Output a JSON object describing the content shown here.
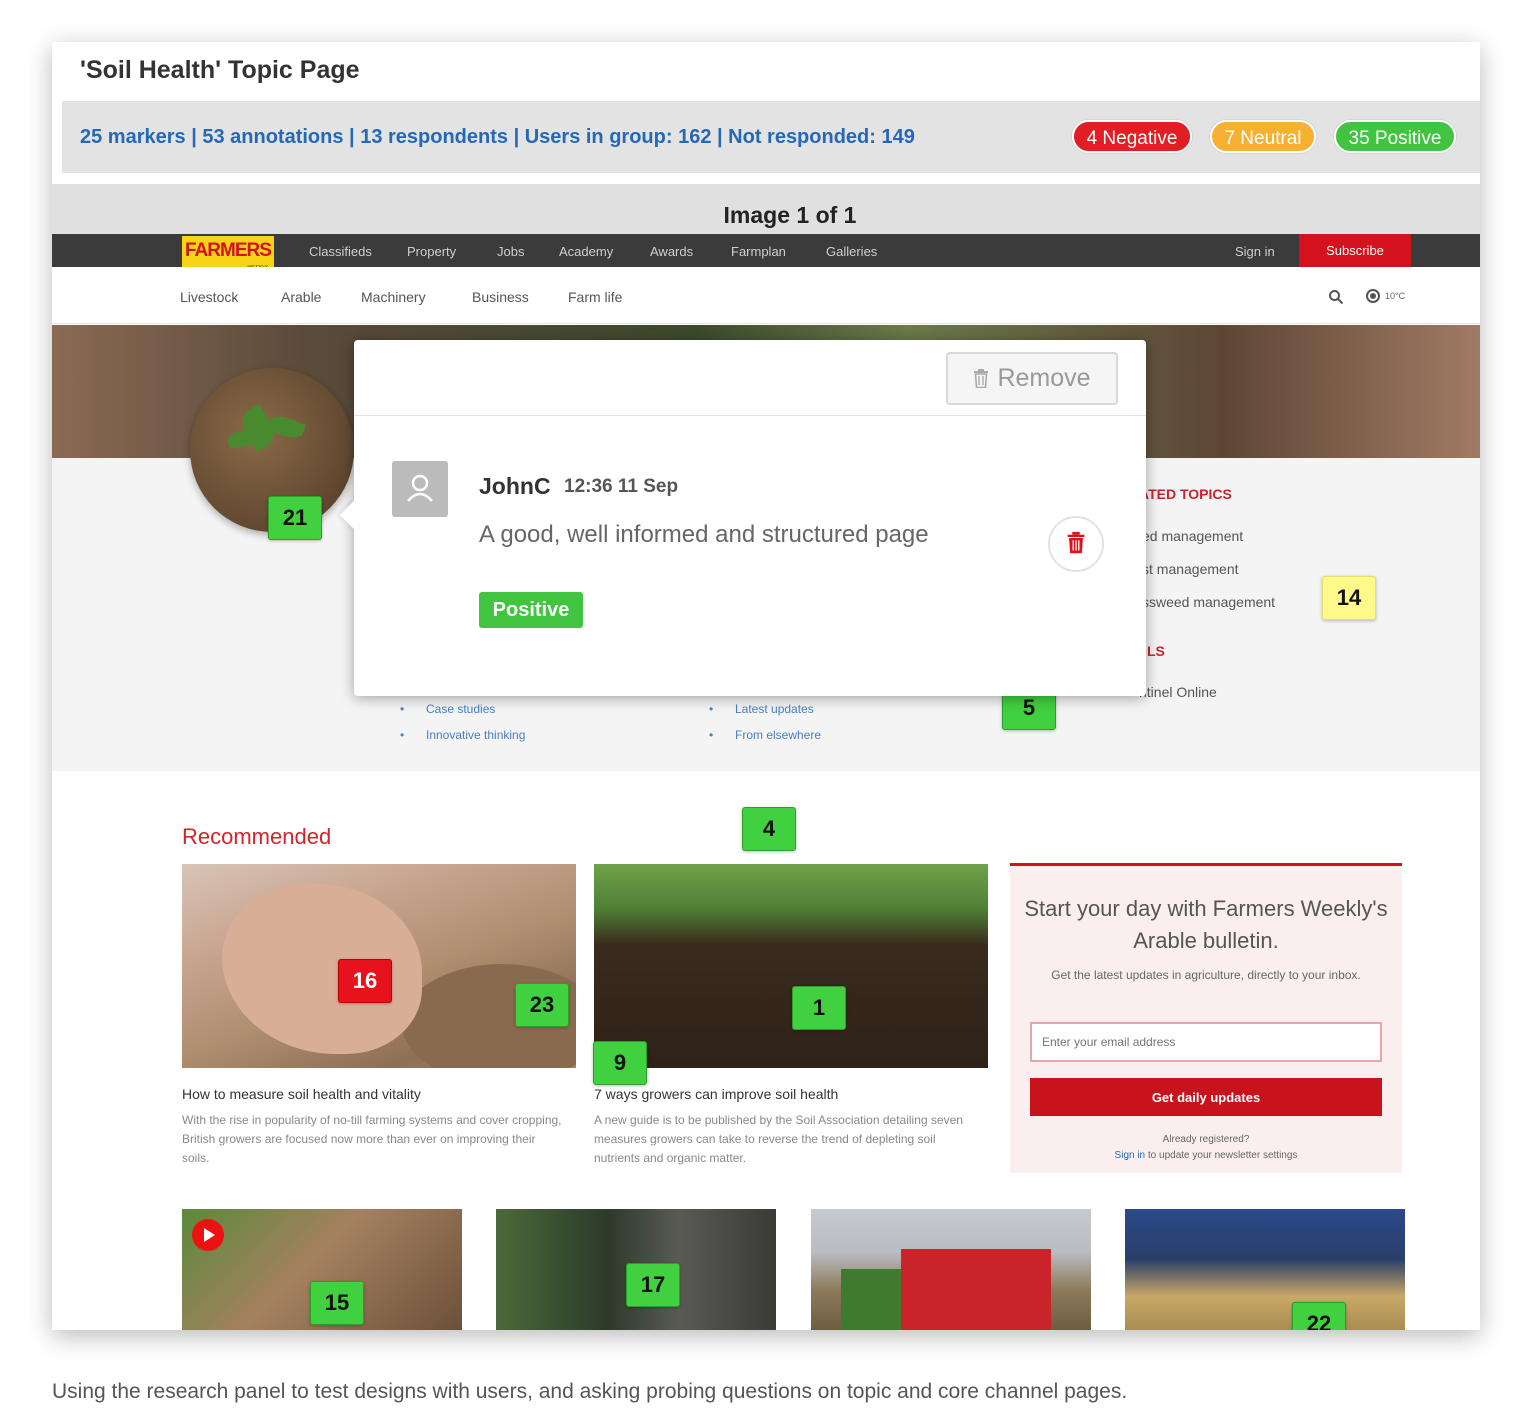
{
  "page": {
    "title": "'Soil Health' Topic Page",
    "caption": "Using the research panel to test designs with users, and asking probing questions on topic and core channel pages."
  },
  "stats": {
    "summary": "25 markers | 53 annotations | 13 respondents | Users in group: 162 | Not responded: 149",
    "negative": "4 Negative",
    "neutral": "7 Neutral",
    "positive": "35 Positive"
  },
  "image_header": "Image 1 of 1",
  "site": {
    "logo": "FARMERS",
    "logo_sub": "WEEKLY",
    "top_nav": [
      "Classifieds",
      "Property",
      "Jobs",
      "Academy",
      "Awards",
      "Farmplan",
      "Galleries"
    ],
    "sign_in": "Sign in",
    "subscribe": "Subscribe",
    "sub_nav": [
      "Livestock",
      "Arable",
      "Machinery",
      "Business",
      "Farm life"
    ],
    "weather": "10°C",
    "related_title": "ATED TOPICS",
    "related": [
      "ed management",
      "st management",
      "ssweed management"
    ],
    "ls_title": "LS",
    "sentinel": "ntinel Online",
    "links_left": [
      "Case studies",
      "Innovative thinking"
    ],
    "links_right": [
      "Latest updates",
      "From elsewhere"
    ],
    "recommended_title": "Recommended",
    "articles": [
      {
        "title": "How to measure soil health and vitality",
        "body": "With the rise in popularity of no-till farming systems and cover cropping, British growers are focused now more than ever on improving their soils."
      },
      {
        "title": "7 ways growers can improve soil health",
        "body": "A new guide is to be published by the Soil Association detailing seven measures growers can take to reverse the trend of depleting soil nutrients and organic matter."
      }
    ],
    "newsletter": {
      "heading": "Start your day with Farmers Weekly's Arable bulletin.",
      "body": "Get the latest updates in agriculture, directly to your inbox.",
      "placeholder": "Enter your email address",
      "button": "Get daily updates",
      "already": "Already registered?",
      "signin_link": "Sign in",
      "signin_rest": " to update your newsletter settings"
    }
  },
  "markers": [
    "21",
    "14",
    "5",
    "4",
    "16",
    "23",
    "1",
    "9",
    "15",
    "17",
    "22"
  ],
  "annotation": {
    "remove": "Remove",
    "author": "JohnC",
    "time": "12:36 11 Sep",
    "comment": "A good, well informed and structured page",
    "sentiment": "Positive"
  },
  "colors": {
    "negative": "#e01e24",
    "neutral": "#f5b12f",
    "positive": "#41c43f",
    "link": "#2668b8",
    "brand_red": "#d4121e"
  }
}
